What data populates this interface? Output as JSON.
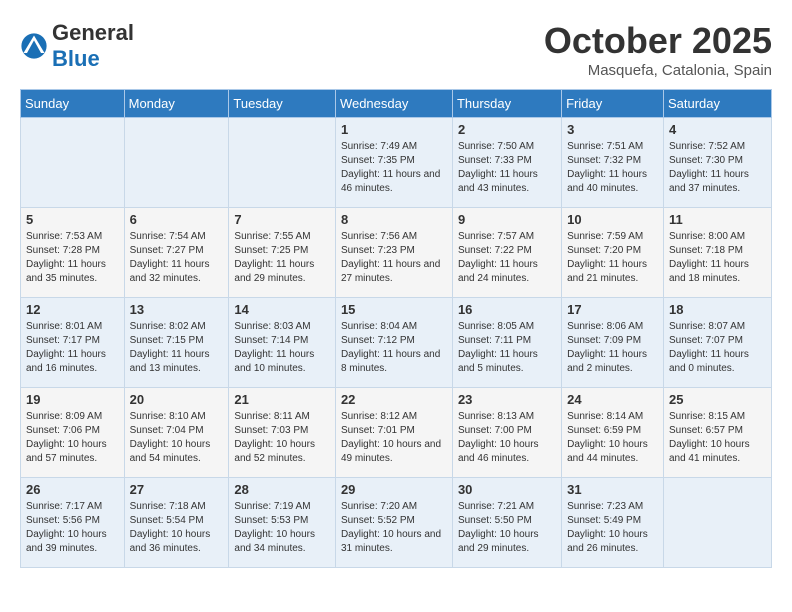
{
  "header": {
    "logo_general": "General",
    "logo_blue": "Blue",
    "month_title": "October 2025",
    "location": "Masquefa, Catalonia, Spain"
  },
  "weekdays": [
    "Sunday",
    "Monday",
    "Tuesday",
    "Wednesday",
    "Thursday",
    "Friday",
    "Saturday"
  ],
  "weeks": [
    [
      {
        "day": "",
        "info": ""
      },
      {
        "day": "",
        "info": ""
      },
      {
        "day": "",
        "info": ""
      },
      {
        "day": "1",
        "info": "Sunrise: 7:49 AM\nSunset: 7:35 PM\nDaylight: 11 hours and 46 minutes."
      },
      {
        "day": "2",
        "info": "Sunrise: 7:50 AM\nSunset: 7:33 PM\nDaylight: 11 hours and 43 minutes."
      },
      {
        "day": "3",
        "info": "Sunrise: 7:51 AM\nSunset: 7:32 PM\nDaylight: 11 hours and 40 minutes."
      },
      {
        "day": "4",
        "info": "Sunrise: 7:52 AM\nSunset: 7:30 PM\nDaylight: 11 hours and 37 minutes."
      }
    ],
    [
      {
        "day": "5",
        "info": "Sunrise: 7:53 AM\nSunset: 7:28 PM\nDaylight: 11 hours and 35 minutes."
      },
      {
        "day": "6",
        "info": "Sunrise: 7:54 AM\nSunset: 7:27 PM\nDaylight: 11 hours and 32 minutes."
      },
      {
        "day": "7",
        "info": "Sunrise: 7:55 AM\nSunset: 7:25 PM\nDaylight: 11 hours and 29 minutes."
      },
      {
        "day": "8",
        "info": "Sunrise: 7:56 AM\nSunset: 7:23 PM\nDaylight: 11 hours and 27 minutes."
      },
      {
        "day": "9",
        "info": "Sunrise: 7:57 AM\nSunset: 7:22 PM\nDaylight: 11 hours and 24 minutes."
      },
      {
        "day": "10",
        "info": "Sunrise: 7:59 AM\nSunset: 7:20 PM\nDaylight: 11 hours and 21 minutes."
      },
      {
        "day": "11",
        "info": "Sunrise: 8:00 AM\nSunset: 7:18 PM\nDaylight: 11 hours and 18 minutes."
      }
    ],
    [
      {
        "day": "12",
        "info": "Sunrise: 8:01 AM\nSunset: 7:17 PM\nDaylight: 11 hours and 16 minutes."
      },
      {
        "day": "13",
        "info": "Sunrise: 8:02 AM\nSunset: 7:15 PM\nDaylight: 11 hours and 13 minutes."
      },
      {
        "day": "14",
        "info": "Sunrise: 8:03 AM\nSunset: 7:14 PM\nDaylight: 11 hours and 10 minutes."
      },
      {
        "day": "15",
        "info": "Sunrise: 8:04 AM\nSunset: 7:12 PM\nDaylight: 11 hours and 8 minutes."
      },
      {
        "day": "16",
        "info": "Sunrise: 8:05 AM\nSunset: 7:11 PM\nDaylight: 11 hours and 5 minutes."
      },
      {
        "day": "17",
        "info": "Sunrise: 8:06 AM\nSunset: 7:09 PM\nDaylight: 11 hours and 2 minutes."
      },
      {
        "day": "18",
        "info": "Sunrise: 8:07 AM\nSunset: 7:07 PM\nDaylight: 11 hours and 0 minutes."
      }
    ],
    [
      {
        "day": "19",
        "info": "Sunrise: 8:09 AM\nSunset: 7:06 PM\nDaylight: 10 hours and 57 minutes."
      },
      {
        "day": "20",
        "info": "Sunrise: 8:10 AM\nSunset: 7:04 PM\nDaylight: 10 hours and 54 minutes."
      },
      {
        "day": "21",
        "info": "Sunrise: 8:11 AM\nSunset: 7:03 PM\nDaylight: 10 hours and 52 minutes."
      },
      {
        "day": "22",
        "info": "Sunrise: 8:12 AM\nSunset: 7:01 PM\nDaylight: 10 hours and 49 minutes."
      },
      {
        "day": "23",
        "info": "Sunrise: 8:13 AM\nSunset: 7:00 PM\nDaylight: 10 hours and 46 minutes."
      },
      {
        "day": "24",
        "info": "Sunrise: 8:14 AM\nSunset: 6:59 PM\nDaylight: 10 hours and 44 minutes."
      },
      {
        "day": "25",
        "info": "Sunrise: 8:15 AM\nSunset: 6:57 PM\nDaylight: 10 hours and 41 minutes."
      }
    ],
    [
      {
        "day": "26",
        "info": "Sunrise: 7:17 AM\nSunset: 5:56 PM\nDaylight: 10 hours and 39 minutes."
      },
      {
        "day": "27",
        "info": "Sunrise: 7:18 AM\nSunset: 5:54 PM\nDaylight: 10 hours and 36 minutes."
      },
      {
        "day": "28",
        "info": "Sunrise: 7:19 AM\nSunset: 5:53 PM\nDaylight: 10 hours and 34 minutes."
      },
      {
        "day": "29",
        "info": "Sunrise: 7:20 AM\nSunset: 5:52 PM\nDaylight: 10 hours and 31 minutes."
      },
      {
        "day": "30",
        "info": "Sunrise: 7:21 AM\nSunset: 5:50 PM\nDaylight: 10 hours and 29 minutes."
      },
      {
        "day": "31",
        "info": "Sunrise: 7:23 AM\nSunset: 5:49 PM\nDaylight: 10 hours and 26 minutes."
      },
      {
        "day": "",
        "info": ""
      }
    ]
  ]
}
